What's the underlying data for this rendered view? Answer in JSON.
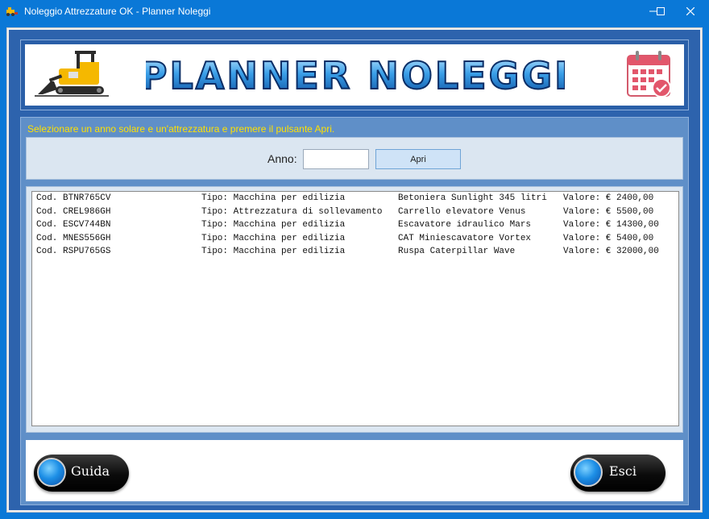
{
  "window": {
    "title": "Noleggio Attrezzature OK - Planner Noleggi",
    "controls": [
      "minimize-icon",
      "maximize-icon",
      "close-icon"
    ]
  },
  "header": {
    "banner_text": "PLANNER NOLEGGI",
    "left_icon": "bulldozer-icon",
    "right_icon": "calendar-check-icon"
  },
  "filter": {
    "instructions": "Selezionare un anno solare e un'attrezzatura e premere il pulsante Apri.",
    "anno_label": "Anno:",
    "anno_value": "",
    "apri_label": "Apri"
  },
  "equipment_list": [
    {
      "code": "Cod. BTNR765CV",
      "type": "Tipo: Macchina per edilizia",
      "name": "Betoniera Sunlight 345 litri",
      "value": "Valore: € 2400,00"
    },
    {
      "code": "Cod. CREL986GH",
      "type": "Tipo: Attrezzatura di sollevamento",
      "name": "Carrello elevatore Venus",
      "value": "Valore: € 5500,00"
    },
    {
      "code": "Cod. ESCV744BN",
      "type": "Tipo: Macchina per edilizia",
      "name": "Escavatore idraulico Mars",
      "value": "Valore: € 14300,00"
    },
    {
      "code": "Cod. MNES556GH",
      "type": "Tipo: Macchina per edilizia",
      "name": "CAT Miniescavatore Vortex",
      "value": "Valore: € 5400,00"
    },
    {
      "code": "Cod. RSPU765GS",
      "type": "Tipo: Macchina per edilizia",
      "name": "Ruspa Caterpillar Wave",
      "value": "Valore: € 32000,00"
    }
  ],
  "footer": {
    "guida_label": "Guida",
    "esci_label": "Esci"
  },
  "colors": {
    "titlebar": "#0a78d7",
    "frame": "#2d63ad",
    "panel": "#5f8fc8",
    "instructions": "#ffe100"
  }
}
